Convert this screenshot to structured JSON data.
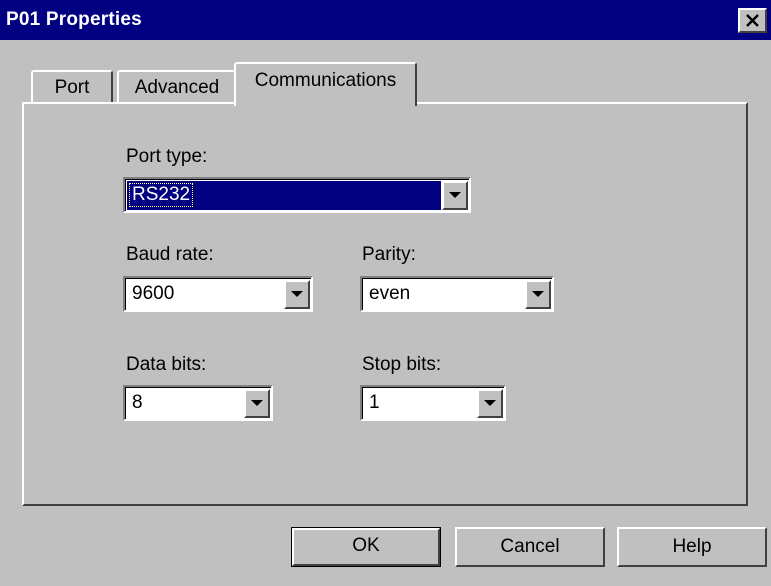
{
  "window": {
    "title": "P01 Properties"
  },
  "tabs": [
    {
      "label": "Port"
    },
    {
      "label": "Advanced"
    },
    {
      "label": "Communications",
      "active": true
    }
  ],
  "fields": {
    "port_type": {
      "label": "Port type:",
      "value": "RS232"
    },
    "baud_rate": {
      "label": "Baud rate:",
      "value": "9600"
    },
    "parity": {
      "label": "Parity:",
      "value": "even"
    },
    "data_bits": {
      "label": "Data bits:",
      "value": "8"
    },
    "stop_bits": {
      "label": "Stop bits:",
      "value": "1"
    }
  },
  "buttons": {
    "ok": "OK",
    "cancel": "Cancel",
    "help": "Help"
  },
  "icons": {
    "close": "close-icon",
    "dropdown": "chevron-down-icon"
  },
  "colors": {
    "titlebar": "#000080",
    "face": "#c0c0c0",
    "selection": "#000080"
  }
}
